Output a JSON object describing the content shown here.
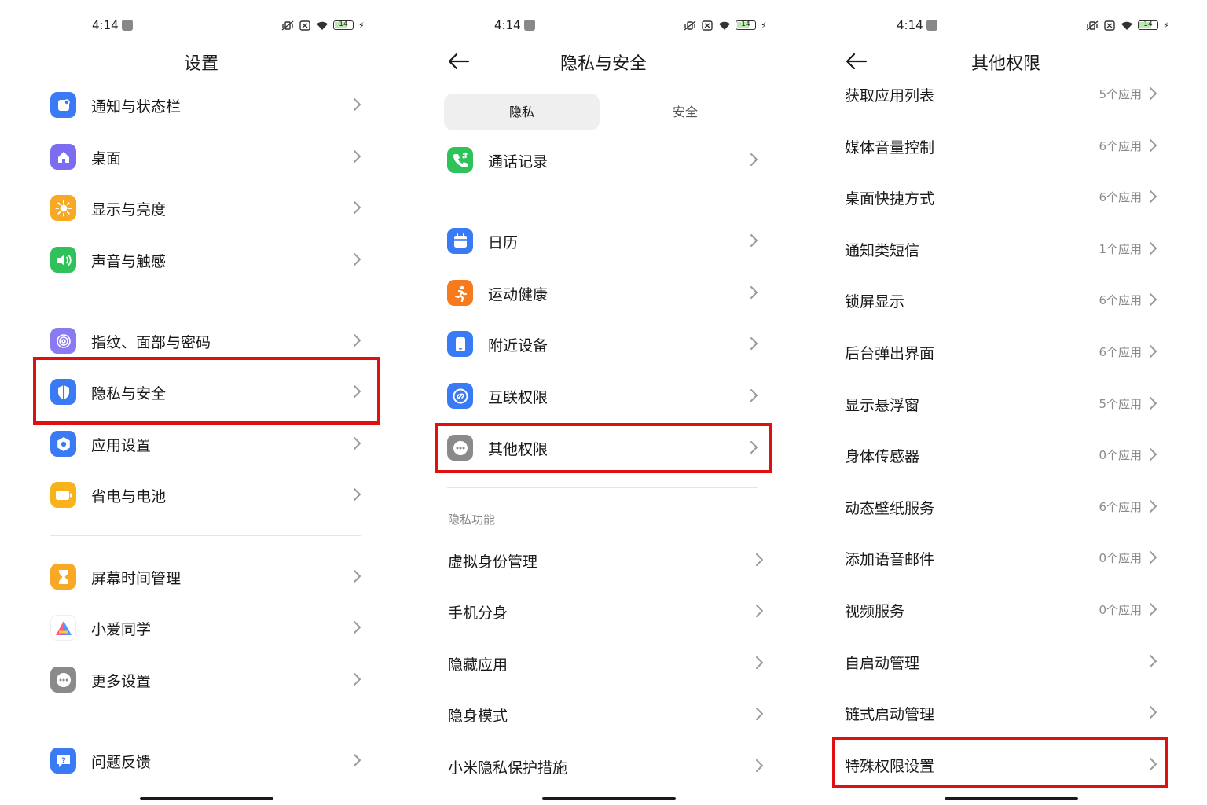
{
  "status": {
    "time": "4:14",
    "battery": "14"
  },
  "settings": {
    "title": "设置",
    "items": [
      {
        "label": "通知与状态栏",
        "icon": "notification-icon",
        "color": "#3a7bf5"
      },
      {
        "label": "桌面",
        "icon": "home-icon",
        "color": "#7b6cf0"
      },
      {
        "label": "显示与亮度",
        "icon": "sun-icon",
        "color": "#f7a824"
      },
      {
        "label": "声音与触感",
        "icon": "speaker-icon",
        "color": "#2fc25a"
      },
      {
        "label": "指纹、面部与密码",
        "icon": "fingerprint-icon",
        "color": "#8a7af2"
      },
      {
        "label": "隐私与安全",
        "icon": "privacy-shield-icon",
        "color": "#3a7bf5"
      },
      {
        "label": "应用设置",
        "icon": "app-settings-icon",
        "color": "#3a7bf5"
      },
      {
        "label": "省电与电池",
        "icon": "battery-icon",
        "color": "#f7b21c"
      },
      {
        "label": "屏幕时间管理",
        "icon": "hourglass-icon",
        "color": "#f7a824"
      },
      {
        "label": "小爱同学",
        "icon": "xiaoai-icon",
        "color": "#ffffff"
      },
      {
        "label": "更多设置",
        "icon": "more-icon",
        "color": "#8a8a8a"
      },
      {
        "label": "问题反馈",
        "icon": "feedback-icon",
        "color": "#3a7bf5"
      }
    ]
  },
  "privacy": {
    "title": "隐私与安全",
    "tabs": [
      "隐私",
      "安全"
    ],
    "items": [
      {
        "label": "通话记录",
        "icon": "phone-log-icon",
        "color": "#2fc25a"
      },
      {
        "label": "日历",
        "icon": "calendar-icon",
        "color": "#3a7bf5"
      },
      {
        "label": "运动健康",
        "icon": "running-icon",
        "color": "#f77b1c"
      },
      {
        "label": "附近设备",
        "icon": "nearby-device-icon",
        "color": "#3a7bf5"
      },
      {
        "label": "互联权限",
        "icon": "link-icon",
        "color": "#3a7bf5"
      },
      {
        "label": "其他权限",
        "icon": "more-icon",
        "color": "#8a8a8a"
      }
    ],
    "section_header": "隐私功能",
    "features": [
      "虚拟身份管理",
      "手机分身",
      "隐藏应用",
      "隐身模式",
      "小米隐私保护措施"
    ]
  },
  "other": {
    "title": "其他权限",
    "items": [
      {
        "label": "获取应用列表",
        "count": "5个应用"
      },
      {
        "label": "媒体音量控制",
        "count": "6个应用"
      },
      {
        "label": "桌面快捷方式",
        "count": "6个应用"
      },
      {
        "label": "通知类短信",
        "count": "1个应用"
      },
      {
        "label": "锁屏显示",
        "count": "6个应用"
      },
      {
        "label": "后台弹出界面",
        "count": "6个应用"
      },
      {
        "label": "显示悬浮窗",
        "count": "5个应用"
      },
      {
        "label": "身体传感器",
        "count": "0个应用"
      },
      {
        "label": "动态壁纸服务",
        "count": "6个应用"
      },
      {
        "label": "添加语音邮件",
        "count": "0个应用"
      },
      {
        "label": "视频服务",
        "count": "0个应用"
      },
      {
        "label": "自启动管理",
        "count": ""
      },
      {
        "label": "链式启动管理",
        "count": ""
      },
      {
        "label": "特殊权限设置",
        "count": ""
      }
    ]
  },
  "highlight_color": "#e01010"
}
